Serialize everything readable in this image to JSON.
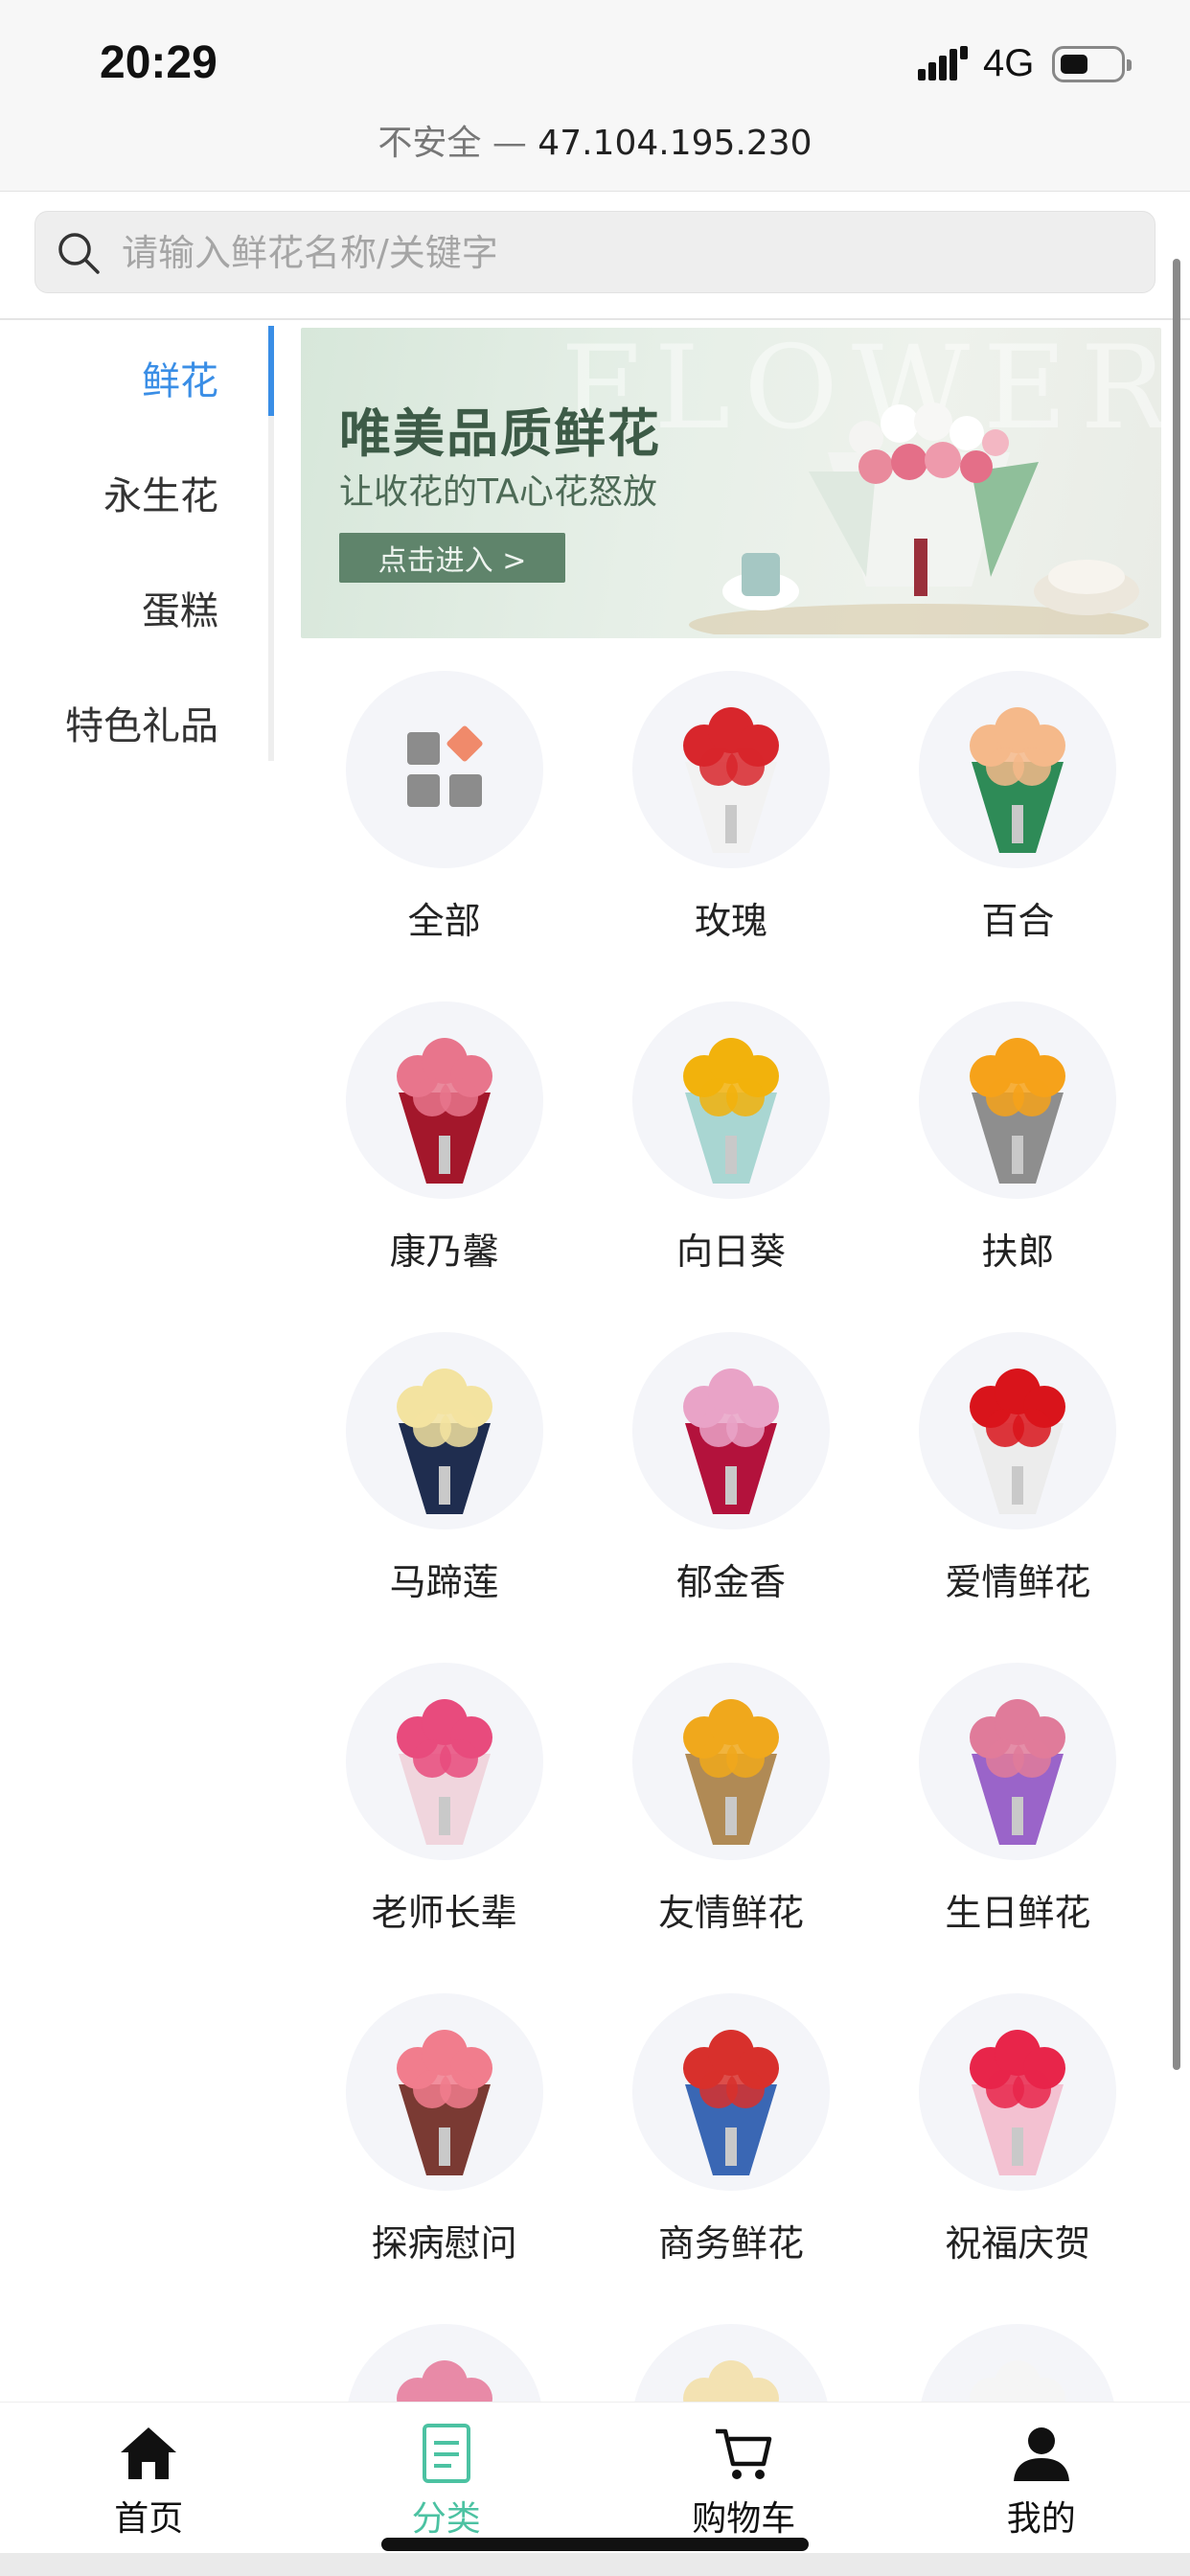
{
  "status_bar": {
    "time": "20:29",
    "network": "4G"
  },
  "url_bar": {
    "prefix": "不安全 — ",
    "host": "47.104.195.230"
  },
  "search": {
    "placeholder": "请输入鲜花名称/关键字"
  },
  "sidebar": {
    "items": [
      {
        "label": "鲜花"
      },
      {
        "label": "永生花"
      },
      {
        "label": "蛋糕"
      },
      {
        "label": "特色礼品"
      }
    ]
  },
  "banner": {
    "watermark": "FLOWER",
    "title": "唯美品质鲜花",
    "subtitle": "让收花的TA心花怒放",
    "button_label": "点击进入 >"
  },
  "categories": [
    {
      "label": "全部",
      "icon": "grid-icon"
    },
    {
      "label": "玫瑰",
      "colors": [
        "#d8262c",
        "#f2f2f2"
      ]
    },
    {
      "label": "百合",
      "colors": [
        "#f5b98a",
        "#2e8b57"
      ]
    },
    {
      "label": "康乃馨",
      "colors": [
        "#e8758c",
        "#a3172b"
      ]
    },
    {
      "label": "向日葵",
      "colors": [
        "#f2b20c",
        "#a9d6d2"
      ]
    },
    {
      "label": "扶郎",
      "colors": [
        "#f6a21a",
        "#8e8e8e"
      ]
    },
    {
      "label": "马蹄莲",
      "colors": [
        "#f3e3a0",
        "#1f2d4f"
      ]
    },
    {
      "label": "郁金香",
      "colors": [
        "#e9a3c7",
        "#b3123c"
      ]
    },
    {
      "label": "爱情鲜花",
      "colors": [
        "#d9141b",
        "#ececec"
      ]
    },
    {
      "label": "老师长辈",
      "colors": [
        "#e84b7d",
        "#f0d5dd"
      ]
    },
    {
      "label": "友情鲜花",
      "colors": [
        "#f0a81c",
        "#b08a55"
      ]
    },
    {
      "label": "生日鲜花",
      "colors": [
        "#e07b9a",
        "#9a64c9"
      ]
    },
    {
      "label": "探病慰问",
      "colors": [
        "#f17d8d",
        "#7a3a33"
      ]
    },
    {
      "label": "商务鲜花",
      "colors": [
        "#d8302c",
        "#3a67b4"
      ]
    },
    {
      "label": "祝福庆贺",
      "colors": [
        "#e8254a",
        "#f3c1d1"
      ]
    },
    {
      "label": "",
      "colors": [
        "#e88aa7",
        "#7a5aa8"
      ]
    },
    {
      "label": "",
      "colors": [
        "#f3e2b2",
        "#7ba35e"
      ]
    },
    {
      "label": "",
      "colors": [
        "#f5f5f5",
        "#2a2f4a"
      ]
    }
  ],
  "tabbar": {
    "items": [
      {
        "label": "首页",
        "icon": "home-icon"
      },
      {
        "label": "分类",
        "icon": "category-icon"
      },
      {
        "label": "购物车",
        "icon": "cart-icon"
      },
      {
        "label": "我的",
        "icon": "user-icon"
      }
    ],
    "active_color": "#4cc2a2"
  },
  "accent_color": "#3a8ee6"
}
